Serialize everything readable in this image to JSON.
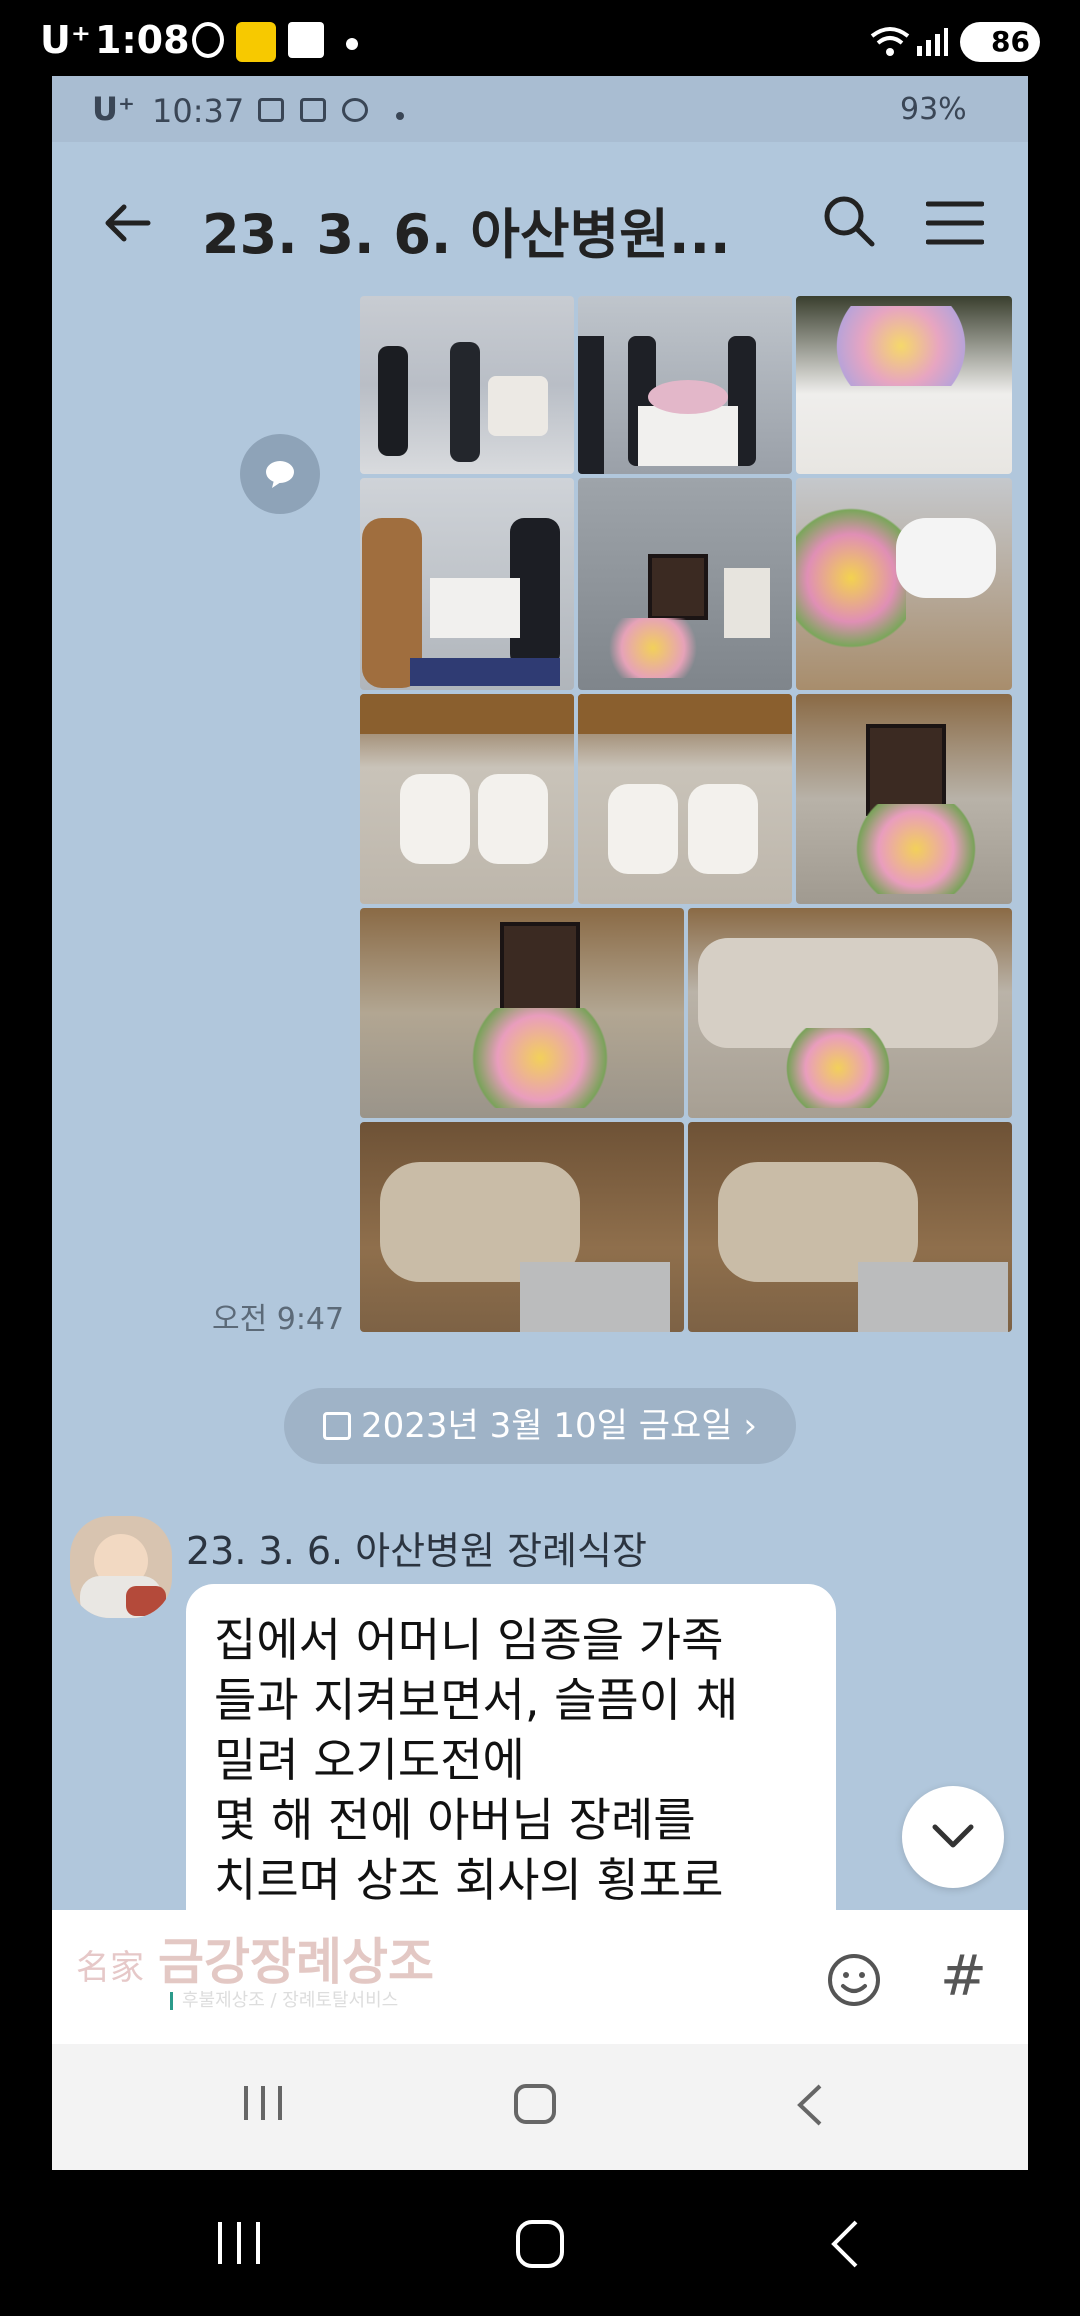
{
  "outer_status": {
    "carrier": "U⁺",
    "time": "1:08",
    "battery": "86"
  },
  "inner_status": {
    "carrier": "U⁺",
    "time": "10:37",
    "battery": "93%"
  },
  "chat": {
    "title": "23. 3. 6. 아산병원..."
  },
  "photos": {
    "timestamp": "오전 9:47"
  },
  "date_divider": {
    "label": "2023년 3월 10일 금요일 ›"
  },
  "message": {
    "sender": "23. 3. 6. 아산병원 장례식장",
    "lines": [
      "집에서 어머니 임종을  가족",
      "들과 지켜보면서, 슬픔이 채",
      "밀려 오기도전에",
      "몇 해 전에 아버님 장례를",
      "치르며 상조 회사의 횡포로"
    ]
  },
  "input": {
    "watermark_small": "名家",
    "watermark": "금강장례상조",
    "watermark_sub": "후불제상조 / 장례토탈서비스",
    "emoji_icon": "emoji-icon",
    "hash": "#"
  },
  "colors": {
    "chat_bg": "#b1c7dc",
    "bubble": "#ffffff"
  }
}
